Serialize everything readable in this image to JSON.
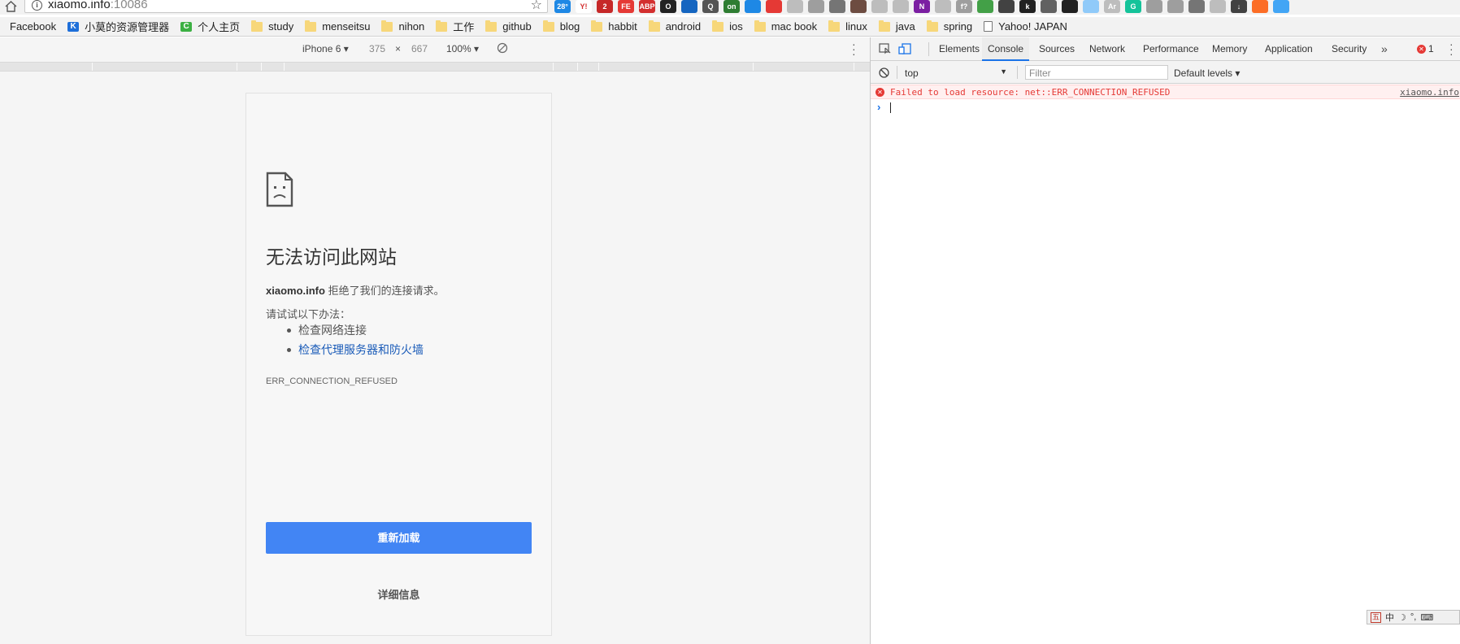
{
  "browser": {
    "url_host": "xiaomo.info",
    "url_port": ":10086"
  },
  "extensions": [
    {
      "name": "weather-ext-icon",
      "color": "#1e88e5",
      "text": "28°"
    },
    {
      "name": "yahoo-ext-icon",
      "color": "#ffffff",
      "text": "Y!"
    },
    {
      "name": "mail-ext-icon",
      "color": "#c62828",
      "text": "2"
    },
    {
      "name": "fe-ext-icon",
      "color": "#e53935",
      "text": "FE"
    },
    {
      "name": "adblock-ext-icon",
      "color": "#d32f2f",
      "text": "ABP"
    },
    {
      "name": "ext-icon-6",
      "color": "#222222",
      "text": "O"
    },
    {
      "name": "ext-icon-7",
      "color": "#1565c0",
      "text": ""
    },
    {
      "name": "ext-icon-8",
      "color": "#555555",
      "text": "Q"
    },
    {
      "name": "ext-icon-9",
      "color": "#2e7d32",
      "text": "on"
    },
    {
      "name": "ext-icon-10",
      "color": "#1e88e5",
      "text": ""
    },
    {
      "name": "ext-icon-11",
      "color": "#e53935",
      "text": ""
    },
    {
      "name": "ext-icon-12",
      "color": "#bdbdbd",
      "text": ""
    },
    {
      "name": "ext-icon-13",
      "color": "#9e9e9e",
      "text": ""
    },
    {
      "name": "ext-icon-14",
      "color": "#757575",
      "text": ""
    },
    {
      "name": "ext-icon-15",
      "color": "#6d4c41",
      "text": ""
    },
    {
      "name": "ext-icon-16",
      "color": "#bdbdbd",
      "text": ""
    },
    {
      "name": "ext-icon-17",
      "color": "#bdbdbd",
      "text": ""
    },
    {
      "name": "onenote-ext-icon",
      "color": "#7b1fa2",
      "text": "N"
    },
    {
      "name": "ext-icon-19",
      "color": "#bdbdbd",
      "text": ""
    },
    {
      "name": "ext-icon-20",
      "color": "#9e9e9e",
      "text": "f?"
    },
    {
      "name": "ext-icon-21",
      "color": "#43a047",
      "text": ""
    },
    {
      "name": "qr-ext-icon",
      "color": "#424242",
      "text": ""
    },
    {
      "name": "ext-icon-23",
      "color": "#212121",
      "text": "k"
    },
    {
      "name": "ext-icon-24",
      "color": "#616161",
      "text": ""
    },
    {
      "name": "ext-icon-25",
      "color": "#212121",
      "text": ""
    },
    {
      "name": "ext-icon-26",
      "color": "#90caf9",
      "text": ""
    },
    {
      "name": "ext-icon-27",
      "color": "#bdbdbd",
      "text": "Ar"
    },
    {
      "name": "grammarly-ext-icon",
      "color": "#15c39a",
      "text": "G"
    },
    {
      "name": "ext-icon-29",
      "color": "#9e9e9e",
      "text": ""
    },
    {
      "name": "ext-icon-30",
      "color": "#9e9e9e",
      "text": ""
    },
    {
      "name": "ext-icon-31",
      "color": "#757575",
      "text": ""
    },
    {
      "name": "ext-icon-32",
      "color": "#bdbdbd",
      "text": ""
    },
    {
      "name": "download-ext-icon",
      "color": "#424242",
      "text": "↓"
    },
    {
      "name": "gitlab-ext-icon",
      "color": "#fc6d26",
      "text": ""
    },
    {
      "name": "cloud-ext-icon",
      "color": "#42a5f5",
      "text": ""
    }
  ],
  "bookmarks": [
    {
      "icon": "none",
      "label": "Facebook"
    },
    {
      "icon": "k",
      "label": "小莫的资源管理器"
    },
    {
      "icon": "c",
      "label": "个人主页"
    },
    {
      "icon": "folder",
      "label": "study"
    },
    {
      "icon": "folder",
      "label": "menseitsu"
    },
    {
      "icon": "folder",
      "label": "nihon"
    },
    {
      "icon": "folder",
      "label": "工作"
    },
    {
      "icon": "folder",
      "label": "github"
    },
    {
      "icon": "folder",
      "label": "blog"
    },
    {
      "icon": "folder",
      "label": "habbit"
    },
    {
      "icon": "folder",
      "label": "android"
    },
    {
      "icon": "folder",
      "label": "ios"
    },
    {
      "icon": "folder",
      "label": "mac book"
    },
    {
      "icon": "folder",
      "label": "linux"
    },
    {
      "icon": "folder",
      "label": "java"
    },
    {
      "icon": "folder",
      "label": "spring"
    },
    {
      "icon": "page",
      "label": "Yahoo! JAPAN"
    }
  ],
  "device_toolbar": {
    "device": "iPhone 6 ▾",
    "width": "375",
    "times": "×",
    "height": "667",
    "zoom": "100% ▾"
  },
  "error_page": {
    "title": "无法访问此网站",
    "host": "xiaomo.info",
    "desc_rest": " 拒绝了我们的连接请求。",
    "try_label": "请试试以下办法：",
    "suggestions": [
      "检查网络连接",
      "检查代理服务器和防火墙"
    ],
    "error_code": "ERR_CONNECTION_REFUSED",
    "reload_label": "重新加载",
    "details_label": "详细信息"
  },
  "devtools": {
    "tabs": [
      "Elements",
      "Console",
      "Sources",
      "Network",
      "Performance",
      "Memory",
      "Application",
      "Security"
    ],
    "active_tab": "Console",
    "more_tabs": "»",
    "error_count": "1",
    "context": "top",
    "filter_placeholder": "Filter",
    "levels": "Default levels ▾",
    "console_error": "Failed to load resource: net::ERR_CONNECTION_REFUSED",
    "console_error_source": "xiaomo.info",
    "prompt": "›"
  },
  "ime": {
    "logo": "五",
    "lang": "中",
    "moon": "☽",
    "punct": "°,",
    "kbd": "⌨"
  },
  "colors": {
    "accent_blue": "#4285f4",
    "error_red": "#e53935",
    "link_blue": "#1a5bb8"
  }
}
